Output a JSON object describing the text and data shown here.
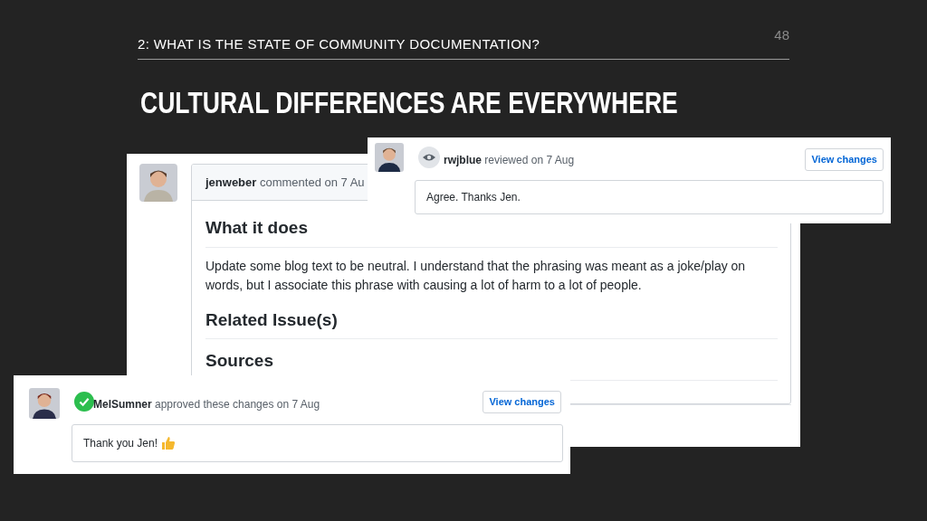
{
  "slide": {
    "section": "2: WHAT IS THE STATE OF COMMUNITY DOCUMENTATION?",
    "page_number": "48",
    "title": "CULTURAL DIFFERENCES ARE EVERYWHERE"
  },
  "comment_panel": {
    "author": "jenweber",
    "action": "commented on 7 Au",
    "blocks": [
      {
        "kind": "heading",
        "text": "What it does"
      },
      {
        "kind": "paragraph",
        "text": "Update some blog text to be neutral. I understand that the phrasing was meant as a joke/play on words, but I associate this phrase with causing a lot of harm to a lot of people."
      },
      {
        "kind": "heading",
        "text": "Related Issue(s)"
      },
      {
        "kind": "heading",
        "text": "Sources"
      }
    ]
  },
  "review_panels": [
    {
      "kind": "eye",
      "author": "rwjblue",
      "action": "reviewed on 7 Aug",
      "button": "View changes",
      "body": "Agree. Thanks Jen.",
      "thumbs_up": false
    },
    {
      "kind": "check",
      "author": "MelSumner",
      "action": "approved these changes on 7 Aug",
      "button": "View changes",
      "body": "Thank you Jen!",
      "thumbs_up": true
    }
  ]
}
